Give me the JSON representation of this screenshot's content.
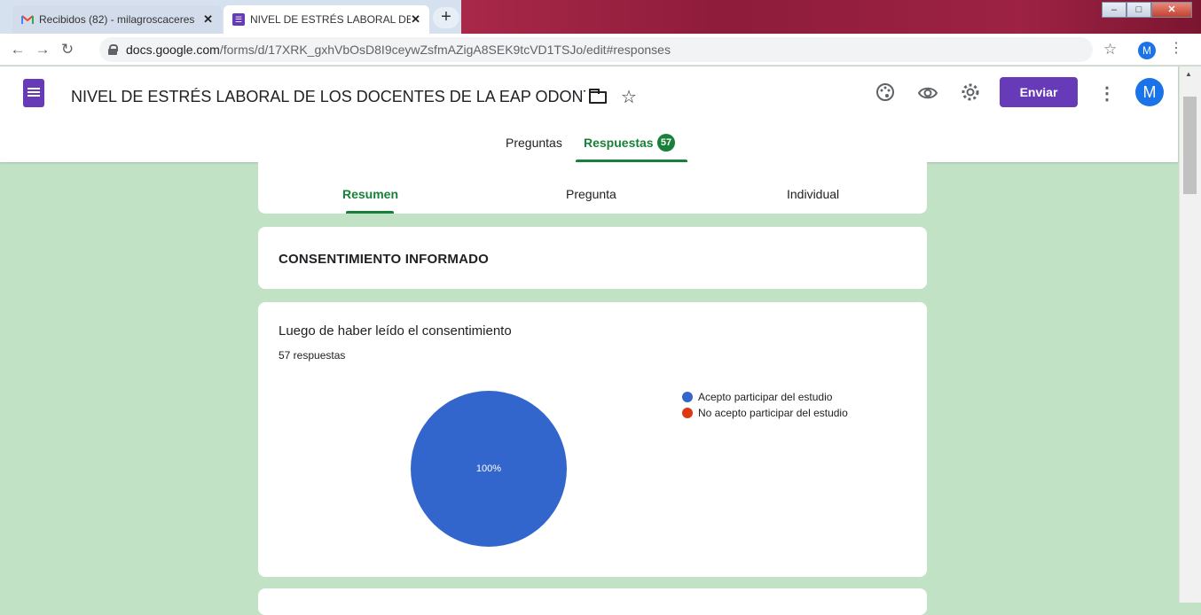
{
  "browser": {
    "tabs": [
      {
        "title": "Recibidos (82) - milagroscaceres",
        "icon": "gmail-icon",
        "active": false
      },
      {
        "title": "NIVEL DE ESTRÉS LABORAL DE LO",
        "icon": "forms-icon",
        "active": true
      }
    ],
    "close_glyph": "✕",
    "newtab_glyph": "+",
    "url_host": "docs.google.com",
    "url_path": "/forms/d/17XRK_gxhVbOsD8I9ceywZsfmAZigA8SEK9tcVD1TSJo/edit#responses",
    "profile_initial": "M"
  },
  "form": {
    "title": "NIVEL DE ESTRÉS LABORAL DE LOS DOCENTES DE LA EAP ODONTOLOG",
    "send_label": "Enviar",
    "avatar_initial": "M",
    "top_tabs": {
      "questions": "Preguntas",
      "responses": "Respuestas",
      "response_count": "57"
    },
    "summary_tabs": [
      "Resumen",
      "Pregunta",
      "Individual"
    ],
    "section_title": "CONSENTIMIENTO INFORMADO",
    "question": {
      "title": "Luego de haber leído el consentimiento",
      "response_count_text": "57 respuestas"
    }
  },
  "chart_data": {
    "type": "pie",
    "slices": [
      {
        "label": "Acepto participar del estudio",
        "value": 100,
        "color": "#3366cc"
      },
      {
        "label": "No acepto participar del estudio",
        "value": 0,
        "color": "#dc3912"
      }
    ],
    "slice_label": "100%",
    "legend_position": "right"
  },
  "colors": {
    "accent": "#673ab7",
    "green": "#188038",
    "background": "#c2e2c6"
  }
}
